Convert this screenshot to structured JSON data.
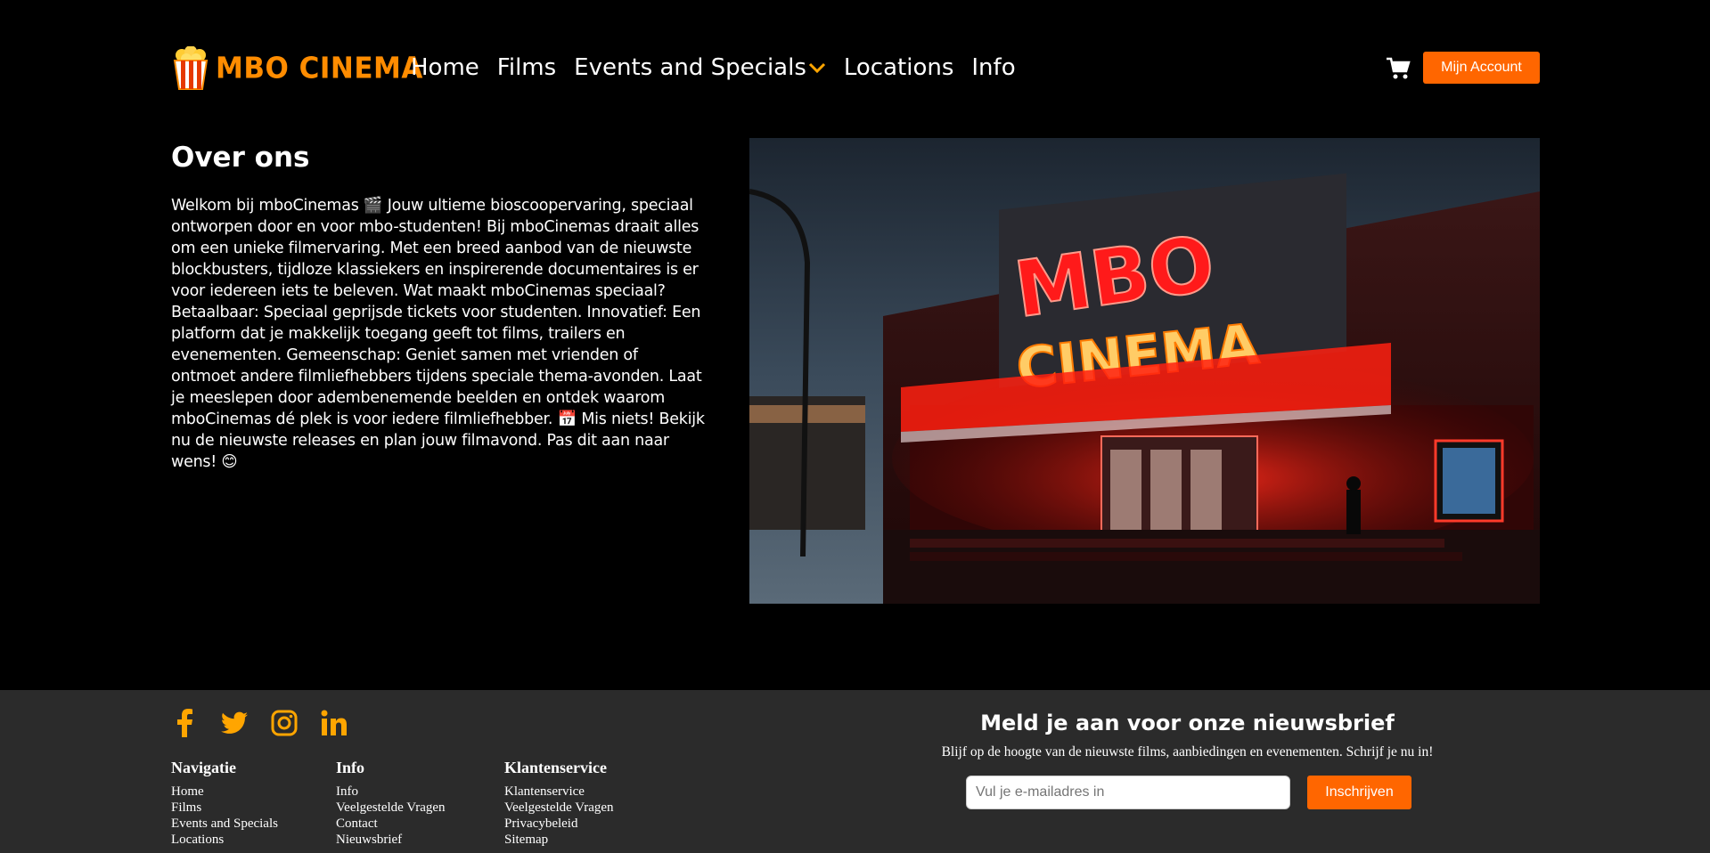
{
  "header": {
    "logo_text": "MBO CINEMA",
    "nav": [
      {
        "label": "Home"
      },
      {
        "label": "Films"
      },
      {
        "label": "Events and Specials"
      },
      {
        "label": "Locations"
      },
      {
        "label": "Info"
      }
    ],
    "account_label": "Mijn Account"
  },
  "about": {
    "title": "Over ons",
    "paragraph": "Welkom bij mboCinemas 🎬 Jouw ultieme bioscoopervaring, speciaal ontworpen door en voor mbo-studenten! Bij mboCinemas draait alles om een unieke filmervaring. Met een breed aanbod van de nieuwste blockbusters, tijdloze klassiekers en inspirerende documentaires is er voor iedereen iets te beleven. Wat maakt mboCinemas speciaal? Betaalbaar: Speciaal geprijsde tickets voor studenten. Innovatief: Een platform dat je makkelijk toegang geeft tot films, trailers en evenementen. Gemeenschap: Geniet samen met vrienden of ontmoet andere filmliefhebbers tijdens speciale thema-avonden. Laat je meeslepen door adembenemende beelden en ontdek waarom mboCinemas dé plek is voor iedere filmliefhebber. 📅 Mis niets! Bekijk nu de nieuwste releases en plan jouw filmavond. Pas dit aan naar wens! 😊"
  },
  "hero": {
    "sign_top": "MBO",
    "sign_bottom": "CINEMA"
  },
  "footer": {
    "social": [
      "facebook-icon",
      "twitter-icon",
      "instagram-icon",
      "linkedin-icon"
    ],
    "columns": [
      {
        "title": "Navigatie",
        "links": [
          "Home",
          "Films",
          "Events and Specials",
          "Locations"
        ]
      },
      {
        "title": "Info",
        "links": [
          "Info",
          "Veelgestelde Vragen",
          "Contact",
          "Nieuwsbrief"
        ]
      },
      {
        "title": "Klantenservice",
        "links": [
          "Klantenservice",
          "Veelgestelde Vragen",
          "Privacybeleid",
          "Sitemap"
        ]
      }
    ],
    "newsletter": {
      "title": "Meld je aan voor onze nieuwsbrief",
      "text": "Blijf op de hoogte van de nieuwste films, aanbiedingen en evenementen. Schrijf je nu in!",
      "placeholder": "Vul je e-mailadres in",
      "button": "Inschrijven"
    }
  },
  "colors": {
    "accent": "#ff6600",
    "logo": "#ff8c00",
    "icon": "#ffa500",
    "footer_bg": "#2b2b2b"
  }
}
